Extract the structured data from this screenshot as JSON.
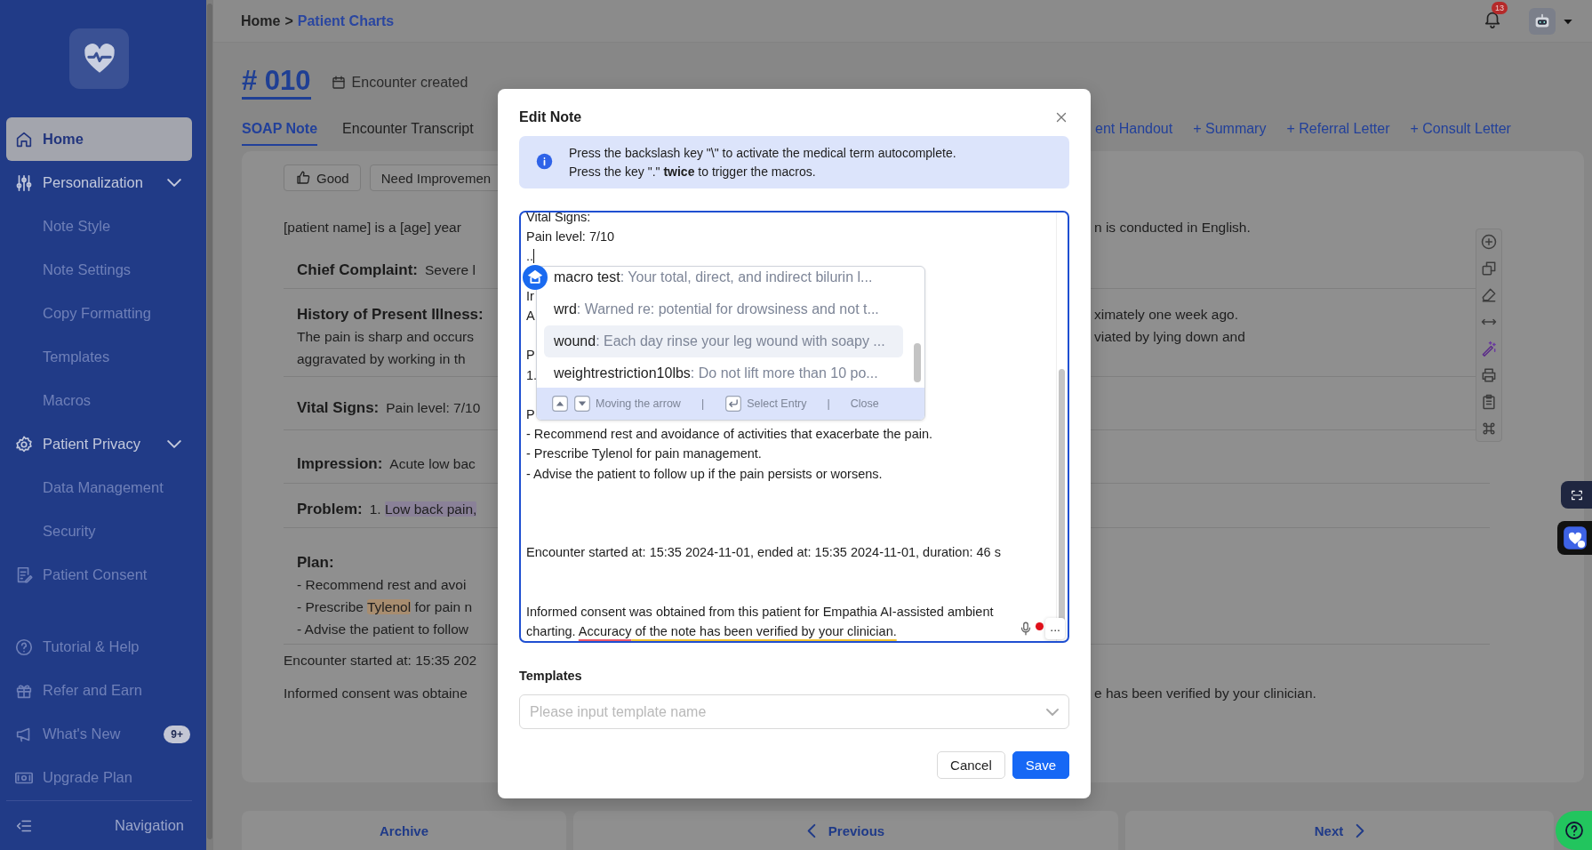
{
  "sidebar": {
    "items": [
      {
        "label": "Home",
        "selected": true
      },
      {
        "label": "Personalization",
        "selected": false,
        "expanded": true,
        "children": [
          {
            "label": "Note Style",
            "selected": false
          },
          {
            "label": "Note Settings",
            "selected": false
          },
          {
            "label": "Copy Formatting",
            "selected": false
          },
          {
            "label": "Templates",
            "selected": false
          },
          {
            "label": "Macros",
            "selected": false
          }
        ]
      },
      {
        "label": "Patient Privacy",
        "selected": false,
        "expanded": true,
        "children": [
          {
            "label": "Data Management",
            "selected": false
          },
          {
            "label": "Security",
            "selected": false
          }
        ]
      },
      {
        "label": "Patient Consent",
        "selected": false
      }
    ],
    "footer_items": [
      {
        "label": "Tutorial & Help",
        "selected": false
      },
      {
        "label": "Refer and Earn",
        "selected": false
      },
      {
        "label": "What's New",
        "selected": false,
        "badge": "9+"
      },
      {
        "label": "Upgrade Plan",
        "selected": false
      }
    ],
    "collapse": "Navigation"
  },
  "top_bar": {
    "breadcrumb": [
      "Home",
      "Patient Charts"
    ],
    "separator": ">",
    "notification_count": "13"
  },
  "chart": {
    "number": "# 010",
    "created": "Encounter created",
    "tabs": [
      {
        "label": "SOAP Note",
        "selected": true
      },
      {
        "label": "Encounter Transcript",
        "selected": false
      }
    ],
    "links": [
      "ent Handout",
      "+ Summary",
      "+ Referral Letter",
      "+ Consult Letter"
    ]
  },
  "note": {
    "feedback": [
      "Good",
      "Need Improvemen"
    ],
    "intro": {
      "left": "[patient name] is a [age] year",
      "right": "n is conducted in English."
    },
    "sections": [
      {
        "heading": "Chief Complaint:",
        "inline": "Severe l"
      },
      {
        "heading": "History of Present Illness:",
        "inline_right": "ximately one week ago.",
        "lines": [
          {
            "left": "The pain is sharp and occurs",
            "right": "viated by lying down and"
          },
          {
            "left": "aggravated by working in th"
          }
        ]
      },
      {
        "heading": "Vital Signs:",
        "inline": "Pain level: 7/10"
      },
      {
        "heading": "Impression:",
        "inline": "Acute low bac"
      },
      {
        "heading": "Problem:",
        "inline": [
          {
            "text": "1. "
          },
          {
            "text": "Low back pain,",
            "kind": "problem"
          }
        ]
      },
      {
        "heading": "Plan:",
        "lines": [
          {
            "left": "- Recommend rest and avoi"
          },
          {
            "left": [
              {
                "text": "- Prescribe "
              },
              {
                "text": "Tylenol",
                "kind": "medication"
              },
              {
                "text": " for pain n"
              }
            ]
          },
          {
            "left": "- Advise the patient to follow"
          }
        ]
      }
    ],
    "footer_lines": [
      {
        "left": "Encounter started at: 15:35 202"
      },
      {
        "left": "Informed consent was obtaine",
        "right": "e has been verified by your clinician."
      }
    ]
  },
  "bottom_nav": [
    "Archive",
    "Previous",
    "Next"
  ],
  "edit_note": {
    "title": "Edit Note",
    "info": [
      "Press the backslash key \"\\\" to activate the medical term autocomplete.",
      "Press the key \".\" **twice** to trigger the macros."
    ],
    "editor": {
      "lines": [
        {
          "kind": "text",
          "text": "Vital Signs:"
        },
        {
          "kind": "text",
          "text": "Pain level: 7/10"
        },
        {
          "kind": "text",
          "text": "..",
          "caret": true
        },
        {
          "kind": "blank"
        },
        {
          "kind": "text",
          "text": "Ir"
        },
        {
          "kind": "text",
          "text": "A"
        },
        {
          "kind": "blank"
        },
        {
          "kind": "text",
          "text": "P"
        },
        {
          "kind": "text",
          "text": "1."
        },
        {
          "kind": "blank"
        },
        {
          "kind": "text",
          "text": "P"
        },
        {
          "kind": "text",
          "text": "- Recommend rest and avoidance of activities that exacerbate the pain."
        },
        {
          "kind": "text",
          "text": "- Prescribe Tylenol for pain management."
        },
        {
          "kind": "text",
          "text": "- Advise the patient to follow up if the pain persists or worsens."
        },
        {
          "kind": "blank"
        },
        {
          "kind": "blank"
        },
        {
          "kind": "blank"
        },
        {
          "kind": "text",
          "text": "Encounter started at: 15:35 2024-11-01, ended at: 15:35 2024-11-01, duration: 46 s"
        },
        {
          "kind": "blank"
        },
        {
          "kind": "blank"
        },
        {
          "kind": "text",
          "text": "Informed consent was obtained from this patient for Empathia AI-assisted ambient"
        },
        {
          "kind": "text",
          "text": [
            {
              "text": "charting. "
            },
            {
              "text": "Accuracy",
              "kind": "spelling"
            },
            {
              "text": " of the note has been verified by your clinician.",
              "kind": "grammar"
            }
          ]
        }
      ],
      "more": "..."
    },
    "macros": {
      "items": [
        {
          "name": "macro test",
          "text": "Your total, direct, and indirect bilurin l...",
          "selected": false
        },
        {
          "name": "wrd",
          "text": "Warned re: potential for drowsiness and not t...",
          "selected": false
        },
        {
          "name": "wound",
          "text": "Each day rinse your leg wound with soapy ...",
          "selected": true
        },
        {
          "name": "weightrestriction10lbs",
          "text": "Do not lift more than 10 po...",
          "selected": false
        }
      ],
      "separator": ":",
      "hints": [
        "Moving the arrow",
        "Select Entry",
        "Close"
      ],
      "divider": "|"
    },
    "templates": {
      "label": "Templates",
      "placeholder": "Please input template name"
    },
    "buttons": [
      {
        "label": "Cancel",
        "kind": "default"
      },
      {
        "label": "Save",
        "kind": "primary"
      }
    ]
  }
}
